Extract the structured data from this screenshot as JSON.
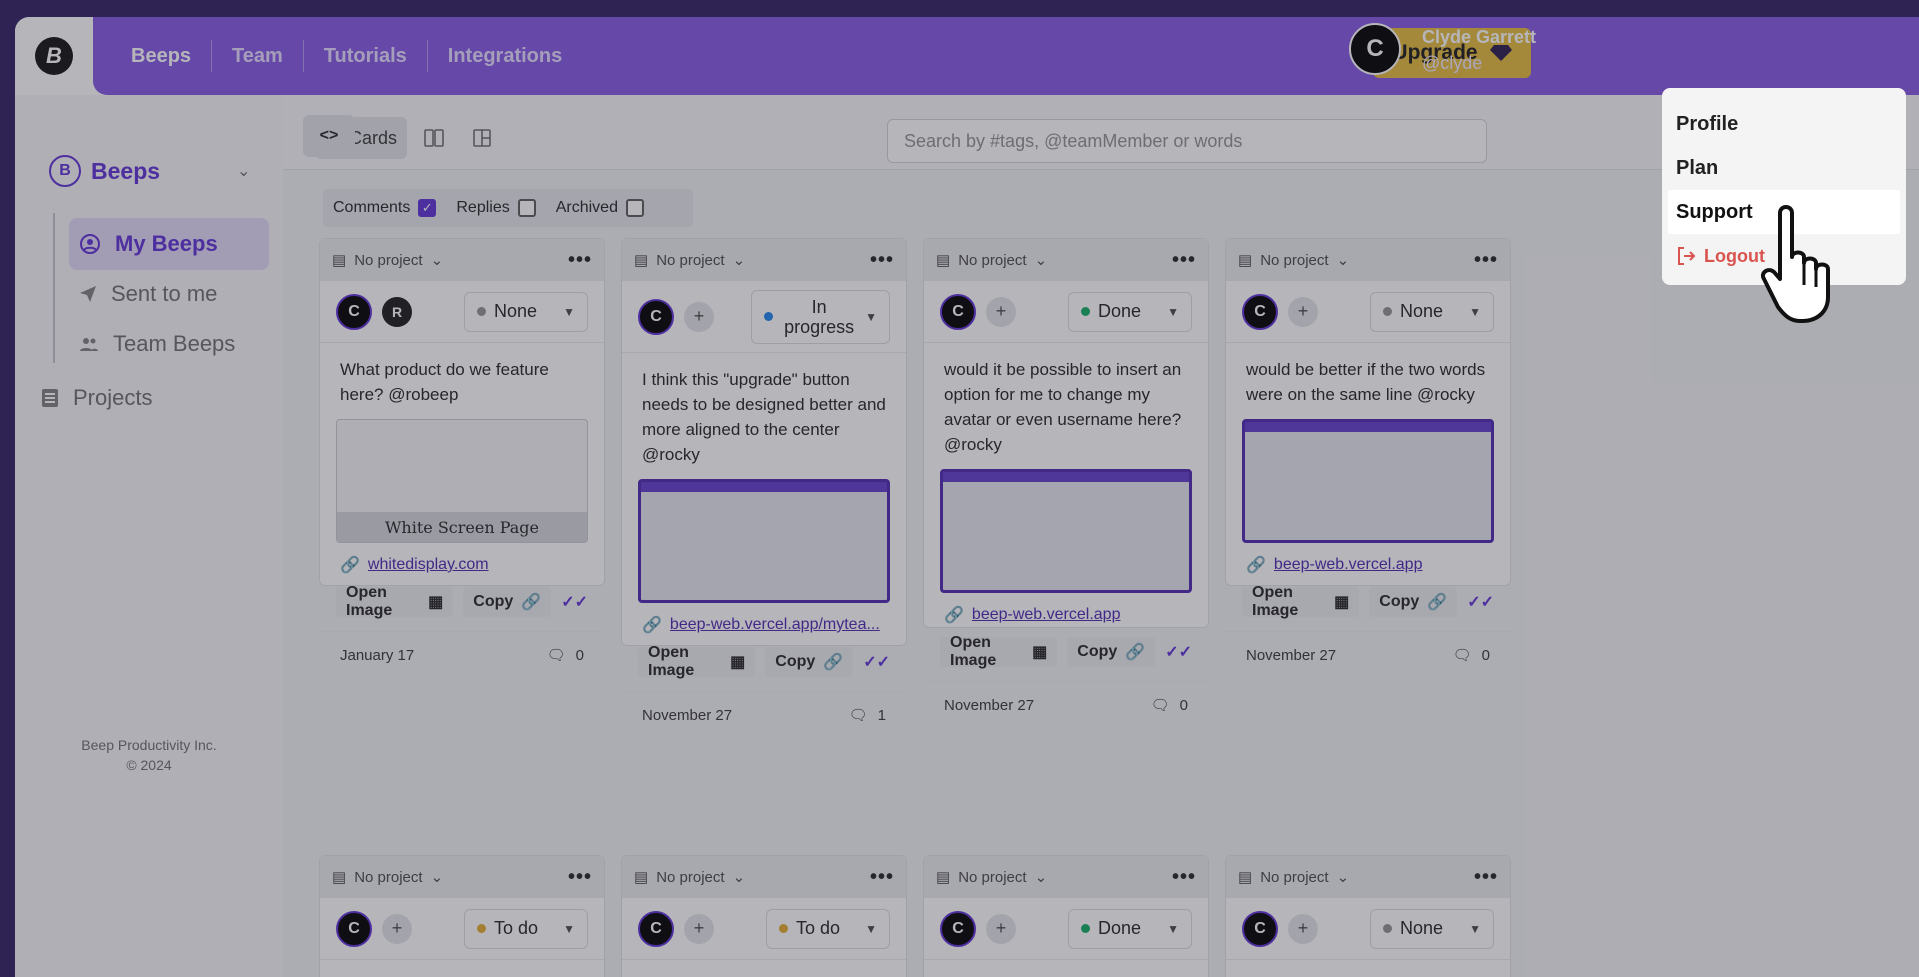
{
  "nav": {
    "tabs": [
      "Beeps",
      "Team",
      "Tutorials",
      "Integrations"
    ]
  },
  "upgrade": {
    "label": "Upgrade"
  },
  "user": {
    "initial": "C",
    "name": "Clyde Garrett",
    "handle": "@clyde"
  },
  "sidebar": {
    "collapse_icon": "<>",
    "workspace": "Beeps",
    "items": [
      {
        "label": "My Beeps",
        "icon": "user-circle-icon"
      },
      {
        "label": "Sent to me",
        "icon": "send-icon"
      },
      {
        "label": "Team Beeps",
        "icon": "team-icon"
      }
    ],
    "projects": "Projects",
    "footer_company": "Beep Productivity Inc.",
    "footer_year": "© 2024"
  },
  "toolbar": {
    "cards_label": "Cards",
    "search_placeholder": "Search by #tags, @teamMember or words"
  },
  "filters": [
    {
      "label": "Comments",
      "checked": true
    },
    {
      "label": "Replies",
      "checked": false
    },
    {
      "label": "Archived",
      "checked": false
    }
  ],
  "cards": [
    {
      "project": "No project",
      "status": "None",
      "status_color": "#9a9a9a",
      "text": "What product do we feature here? @robeep",
      "thumb_caption": "White Screen Page",
      "link": "whitedisplay.com",
      "date": "January 17",
      "comments": "0"
    },
    {
      "project": "No project",
      "status": "In progress",
      "status_color": "#2f8cf0",
      "text": "I think this \"upgrade\" button needs to be designed better and more aligned to the center @rocky",
      "link": "beep-web.vercel.app/mytea...",
      "date": "November 27",
      "comments": "1"
    },
    {
      "project": "No project",
      "status": "Done",
      "status_color": "#23b26d",
      "text": "would it be possible to insert an option for me to change my avatar or even username here? @rocky",
      "link": "beep-web.vercel.app",
      "date": "November 27",
      "comments": "0"
    },
    {
      "project": "No project",
      "status": "None",
      "status_color": "#9a9a9a",
      "text": "would be better if the two words were on the same line @rocky",
      "link": "beep-web.vercel.app",
      "date": "November 27",
      "comments": "0"
    }
  ],
  "bottom_cards": [
    {
      "project": "No project",
      "status": "To do",
      "status_color": "#e8b23c"
    },
    {
      "project": "No project",
      "status": "To do",
      "status_color": "#e8b23c"
    },
    {
      "project": "No project",
      "status": "Done",
      "status_color": "#23b26d"
    },
    {
      "project": "No project",
      "status": "None",
      "status_color": "#9a9a9a"
    }
  ],
  "card_actions": {
    "open_image": "Open Image",
    "copy": "Copy"
  },
  "dropdown": {
    "items": [
      "Profile",
      "Plan",
      "Support"
    ],
    "logout": "Logout"
  }
}
